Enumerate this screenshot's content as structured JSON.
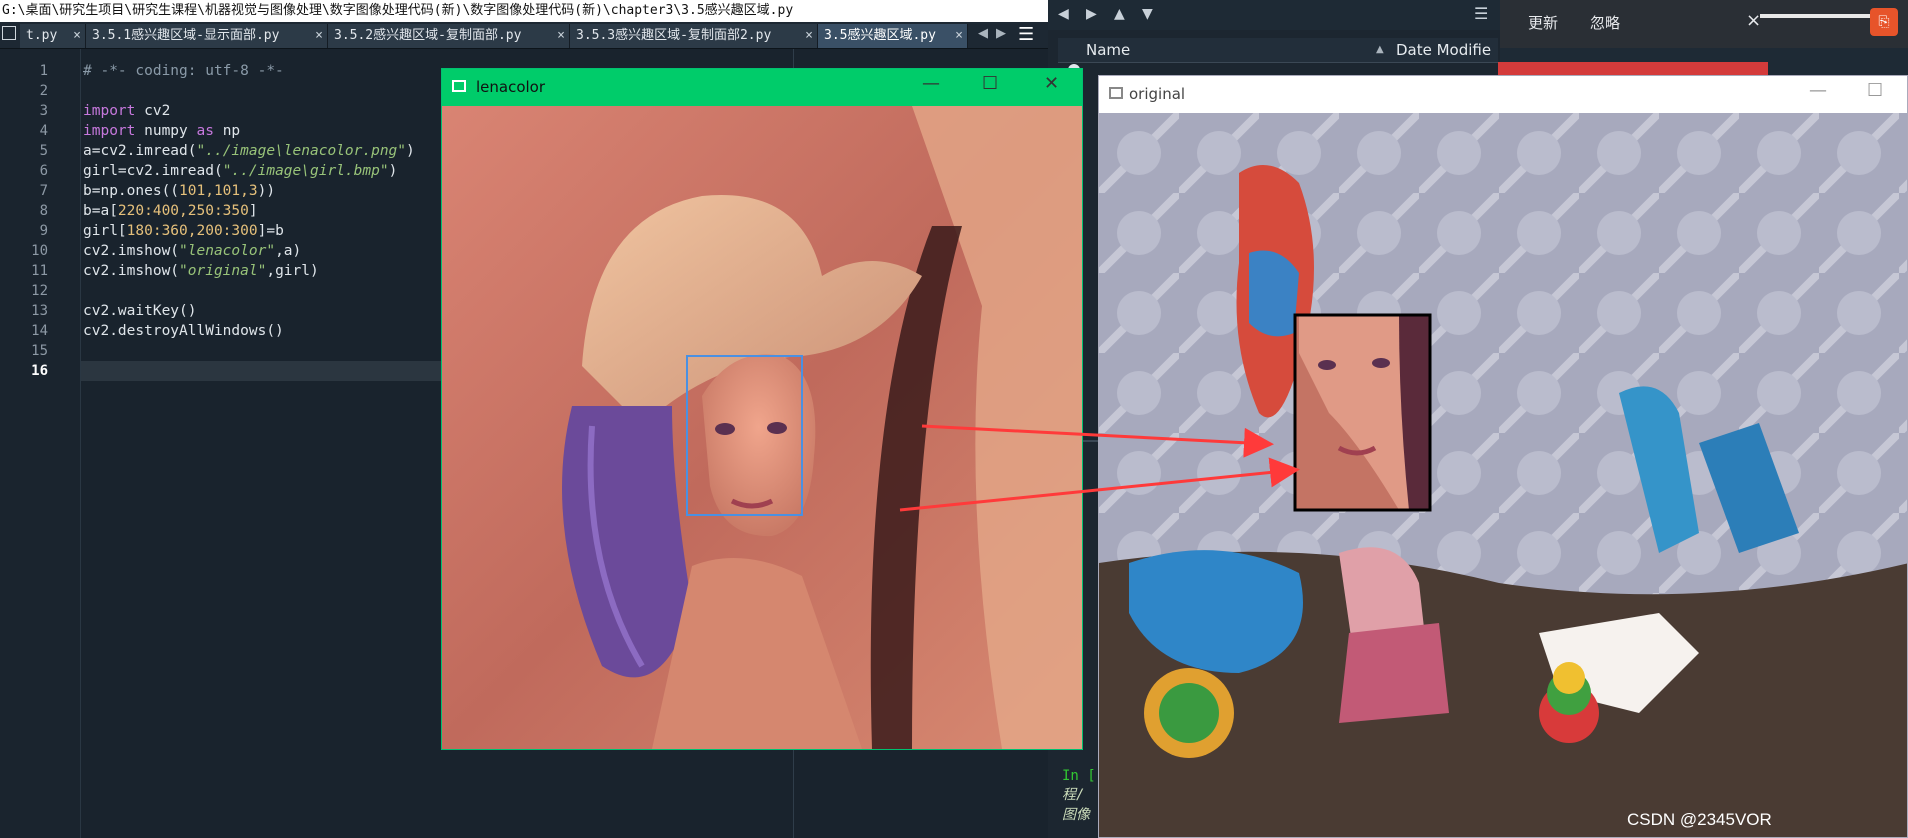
{
  "path_bar": "G:\\桌面\\研究生项目\\研究生课程\\机器视觉与图像处理\\数字图像处理代码(新)\\数字图像处理代码(新)\\chapter3\\3.5感兴趣区域.py",
  "tabs": [
    {
      "label": "t.py"
    },
    {
      "label": "3.5.1感兴趣区域-显示面部.py"
    },
    {
      "label": "3.5.2感兴趣区域-复制面部.py"
    },
    {
      "label": "3.5.3感兴趣区域-复制面部2.py"
    },
    {
      "label": "3.5感兴趣区域.py",
      "active": true
    }
  ],
  "editor": {
    "line_numbers": [
      "1",
      "2",
      "3",
      "4",
      "5",
      "6",
      "7",
      "8",
      "9",
      "10",
      "11",
      "12",
      "13",
      "14",
      "15",
      "16"
    ],
    "current_line": "16",
    "code": {
      "l1": "# -*- coding: utf-8 -*-",
      "l3_kw": "import",
      "l3_rest": " cv2",
      "l4_kw": "import",
      "l4_mid": " numpy ",
      "l4_kw2": "as",
      "l4_rest": " np",
      "l5_a": "a=cv2.imread(",
      "l5_str": "\"../image\\lenacolor.png\"",
      "l5_b": ")",
      "l6_a": "girl=cv2.imread(",
      "l6_str": "\"../image\\girl.bmp\"",
      "l6_b": ")",
      "l7_a": "b=np.ones((",
      "l7_n": "101,101,3",
      "l7_b": "))",
      "l8_a": "b=a[",
      "l8_n": "220:400,250:350",
      "l8_b": "]",
      "l9_a": "girl[",
      "l9_n": "180:360,200:300",
      "l9_b": "]=b",
      "l10_a": "cv2.imshow(",
      "l10_str": "\"lenacolor\"",
      "l10_b": ",a)",
      "l11_a": "cv2.imshow(",
      "l11_str": "\"original\"",
      "l11_b": ",girl)",
      "l13": "cv2.waitKey()",
      "l14": "cv2.destroyAllWindows()"
    }
  },
  "file_browser": {
    "column_name": "Name",
    "column_date": "Date Modifie"
  },
  "notification": {
    "update_label": "更新",
    "ignore_label": "忽略"
  },
  "windows": {
    "lena_title": "lenacolor",
    "original_title": "original"
  },
  "console_fragments": [
    "In [",
    "程/",
    "图像"
  ],
  "watermark": "CSDN @2345VOR",
  "colors": {
    "lena_titlebar": "#00cc6a",
    "roi_box_lena": "#4a90e2",
    "roi_box_original": "#000000",
    "arrows": "#ff3a3a"
  }
}
